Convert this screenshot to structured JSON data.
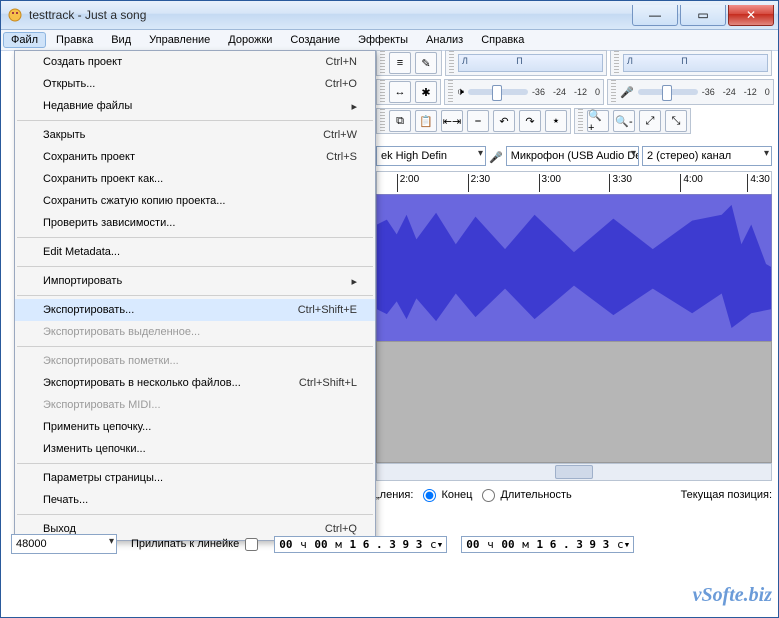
{
  "window": {
    "title": "testtrack - Just a song"
  },
  "menubar": [
    "Файл",
    "Правка",
    "Вид",
    "Управление",
    "Дорожки",
    "Создание",
    "Эффекты",
    "Анализ",
    "Справка"
  ],
  "file_menu": [
    {
      "label": "Создать проект",
      "shortcut": "Ctrl+N"
    },
    {
      "label": "Открыть...",
      "shortcut": "Ctrl+O"
    },
    {
      "label": "Недавние файлы",
      "sub": true
    },
    {
      "sep": true
    },
    {
      "label": "Закрыть",
      "shortcut": "Ctrl+W"
    },
    {
      "label": "Сохранить проект",
      "shortcut": "Ctrl+S"
    },
    {
      "label": "Сохранить проект как..."
    },
    {
      "label": "Сохранить сжатую копию проекта..."
    },
    {
      "label": "Проверить зависимости..."
    },
    {
      "sep": true
    },
    {
      "label": "Edit Metadata..."
    },
    {
      "sep": true
    },
    {
      "label": "Импортировать",
      "sub": true
    },
    {
      "sep": true
    },
    {
      "label": "Экспортировать...",
      "shortcut": "Ctrl+Shift+E",
      "hi": true
    },
    {
      "label": "Экспортировать выделенное...",
      "disabled": true
    },
    {
      "sep": true
    },
    {
      "label": "Экспортировать пометки...",
      "disabled": true
    },
    {
      "label": "Экспортировать в несколько файлов...",
      "shortcut": "Ctrl+Shift+L"
    },
    {
      "label": "Экспортировать MIDI...",
      "disabled": true
    },
    {
      "label": "Применить цепочку..."
    },
    {
      "label": "Изменить цепочки..."
    },
    {
      "sep": true
    },
    {
      "label": "Параметры страницы..."
    },
    {
      "label": "Печать..."
    },
    {
      "sep": true
    },
    {
      "label": "Выход",
      "shortcut": "Ctrl+Q"
    }
  ],
  "meters": {
    "left_L": "Л",
    "left_P": "П",
    "right_L": "Л",
    "right_P": "П",
    "ticks": [
      "-36",
      "-24",
      "-12",
      "0"
    ]
  },
  "device": {
    "host": "ek High Defin",
    "input": "Микрофон (USB Audio Device)",
    "channels": "2 (стерео) канал"
  },
  "ruler": [
    "2:00",
    "2:30",
    "3:00",
    "3:30",
    "4:00",
    "4:30"
  ],
  "selection": {
    "suffix_label": "„ления:",
    "end_label": "Конец",
    "length_label": "Длительность",
    "curpos_label": "Текущая позиция:",
    "time_parts": {
      "h": "00",
      "hU": "ч",
      "m": "00",
      "mU": "м",
      "s": "1 6 . 3 9 3",
      "sU": "с"
    }
  },
  "rate": {
    "value": "48000",
    "snap_label": "Прилипать к линейке"
  },
  "watermark": "vSofte.biz"
}
